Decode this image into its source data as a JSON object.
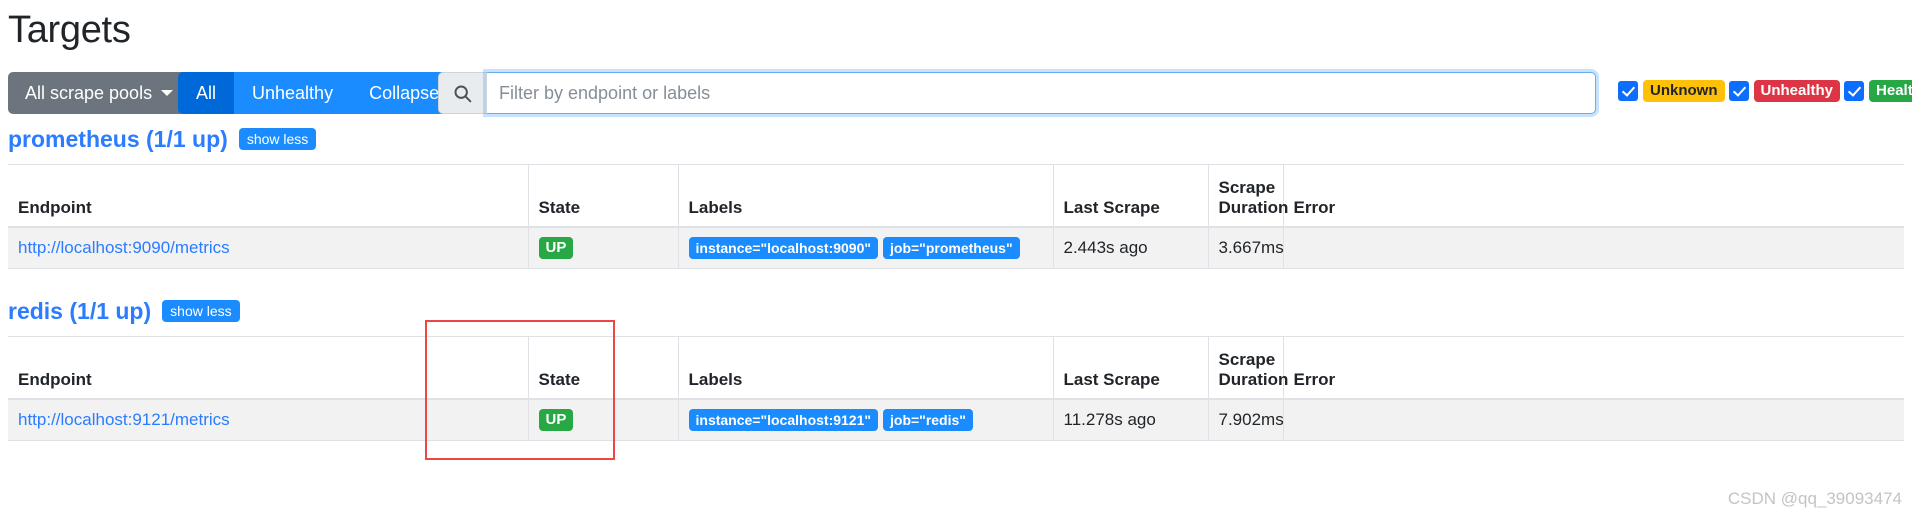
{
  "page": {
    "title": "Targets",
    "watermark": "CSDN @qq_39093474"
  },
  "toolbar": {
    "pool_dropdown_label": "All scrape pools",
    "buttons": [
      {
        "label": "All",
        "active": true
      },
      {
        "label": "Unhealthy",
        "active": false
      },
      {
        "label": "Collapse All",
        "active": false
      }
    ],
    "search": {
      "icon": "search-icon",
      "placeholder": "Filter by endpoint or labels",
      "value": ""
    },
    "status_filters": [
      {
        "label": "Unknown",
        "checked": true,
        "color": "#ffc107"
      },
      {
        "label": "Unhealthy",
        "checked": true,
        "color": "#dc3545"
      },
      {
        "label": "Healthy",
        "checked": true,
        "color": "#28a745"
      }
    ]
  },
  "columns": {
    "endpoint": "Endpoint",
    "state": "State",
    "labels": "Labels",
    "last_scrape": "Last Scrape",
    "scrape_duration_line1": "Scrape",
    "scrape_duration_line2": "Duration",
    "error": "Error"
  },
  "jobs": [
    {
      "title": "prometheus (1/1 up)",
      "toggle_label": "show less",
      "rows": [
        {
          "endpoint": "http://localhost:9090/metrics",
          "state": "UP",
          "labels": [
            "instance=\"localhost:9090\"",
            "job=\"prometheus\""
          ],
          "last_scrape": "2.443s ago",
          "scrape_duration": "3.667ms",
          "error": ""
        }
      ]
    },
    {
      "title": "redis (1/1 up)",
      "toggle_label": "show less",
      "rows": [
        {
          "endpoint": "http://localhost:9121/metrics",
          "state": "UP",
          "labels": [
            "instance=\"localhost:9121\"",
            "job=\"redis\""
          ],
          "last_scrape": "11.278s ago",
          "scrape_duration": "7.902ms",
          "error": ""
        }
      ]
    }
  ],
  "annotation": {
    "color": "#f04545",
    "target": "state-column-redis"
  }
}
